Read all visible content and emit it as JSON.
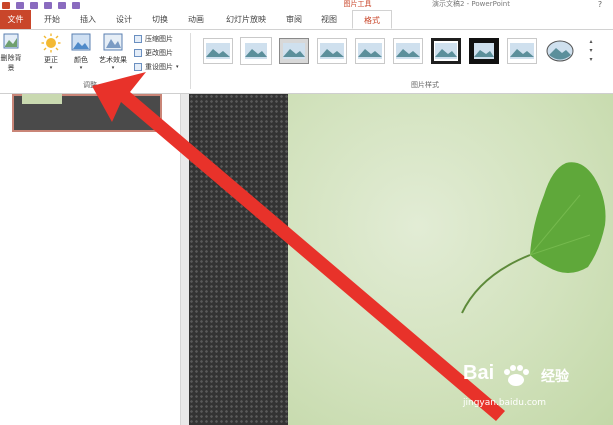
{
  "app": {
    "title": "演示文稿2 - PowerPoint",
    "context_group": "图片工具"
  },
  "tabs": [
    "文件",
    "开始",
    "插入",
    "设计",
    "切换",
    "动画",
    "幻灯片放映",
    "审阅",
    "视图",
    "格式"
  ],
  "active_tab": "格式",
  "ribbon": {
    "remove_bg": "删除背景",
    "corrections": "更正",
    "color": "颜色",
    "artistic": "艺术效果",
    "compress": "压缩图片",
    "change": "更改图片",
    "reset": "重设图片",
    "adjust_group": "调整",
    "styles_group": "图片样式"
  },
  "picture_styles_count": 10,
  "watermark": {
    "brand": "Bai",
    "brand_suffix": "经验",
    "url": "jingyan.baidu.com"
  },
  "colors": {
    "accent": "#c9462a",
    "arrow": "#e8322a",
    "slide_green": "#d2e2bd",
    "slide_dark": "#333333"
  }
}
